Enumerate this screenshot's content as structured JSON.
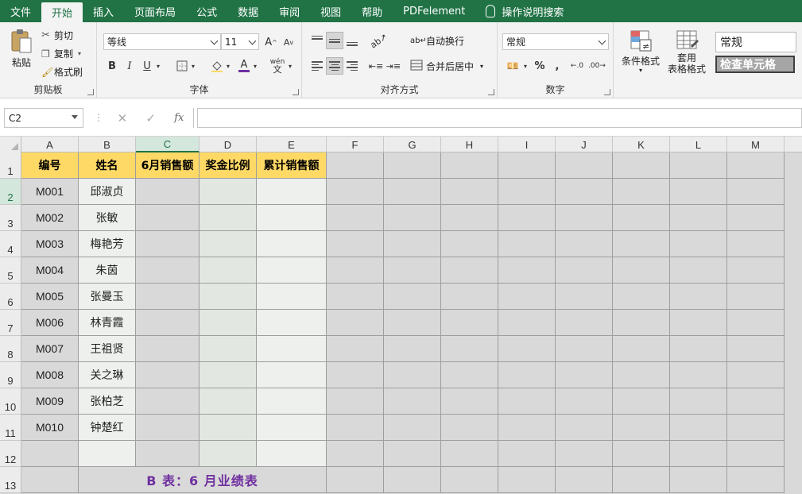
{
  "menu": {
    "tabs": [
      "文件",
      "开始",
      "插入",
      "页面布局",
      "公式",
      "数据",
      "审阅",
      "视图",
      "帮助",
      "PDFelement"
    ],
    "active_index": 1,
    "tell_me": "操作说明搜索"
  },
  "ribbon": {
    "clipboard": {
      "paste": "粘贴",
      "cut": "剪切",
      "copy": "复制",
      "format_painter": "格式刷",
      "label": "剪贴板"
    },
    "font": {
      "name": "等线",
      "size": "11",
      "bold": "B",
      "italic": "I",
      "underline": "U",
      "font_color": "A",
      "phonetic": "wén",
      "grow": "A",
      "shrink": "A",
      "label": "字体"
    },
    "alignment": {
      "wrap_text": "自动换行",
      "merge_center": "合并后居中",
      "label": "对齐方式"
    },
    "number": {
      "format": "常规",
      "percent": "%",
      "comma": ",",
      "inc_decimal": "←.0",
      "dec_decimal": ".00→",
      "label": "数字"
    },
    "styles": {
      "conditional": "条件格式",
      "table_line1": "套用",
      "table_line2": "表格格式",
      "normal": "常规",
      "check_cell": "检查单元格"
    }
  },
  "formula_bar": {
    "name_box": "C2",
    "cancel": "✕",
    "enter": "✓",
    "fx": "fx",
    "value": ""
  },
  "sheet": {
    "columns": [
      "A",
      "B",
      "C",
      "D",
      "E",
      "F",
      "G",
      "H",
      "I",
      "J",
      "K",
      "L",
      "M"
    ],
    "selected_column": "C",
    "selected_row": 2,
    "rows": [
      "1",
      "2",
      "3",
      "4",
      "5",
      "6",
      "7",
      "8",
      "9",
      "10",
      "11",
      "12",
      "13"
    ],
    "headers": [
      "编号",
      "姓名",
      "6月销售额",
      "奖金比例",
      "累计销售额"
    ],
    "records": [
      {
        "id": "M001",
        "name": "邱淑贞"
      },
      {
        "id": "M002",
        "name": "张敏"
      },
      {
        "id": "M003",
        "name": "梅艳芳"
      },
      {
        "id": "M004",
        "name": "朱茵"
      },
      {
        "id": "M005",
        "name": "张曼玉"
      },
      {
        "id": "M006",
        "name": "林青霞"
      },
      {
        "id": "M007",
        "name": "王祖贤"
      },
      {
        "id": "M008",
        "name": "关之琳"
      },
      {
        "id": "M009",
        "name": "张柏芝"
      },
      {
        "id": "M010",
        "name": "钟楚红"
      }
    ],
    "caption": "B 表：6 月业绩表"
  },
  "colors": {
    "brand": "#217346",
    "header_fill": "#ffd966",
    "caption": "#7030a0"
  }
}
